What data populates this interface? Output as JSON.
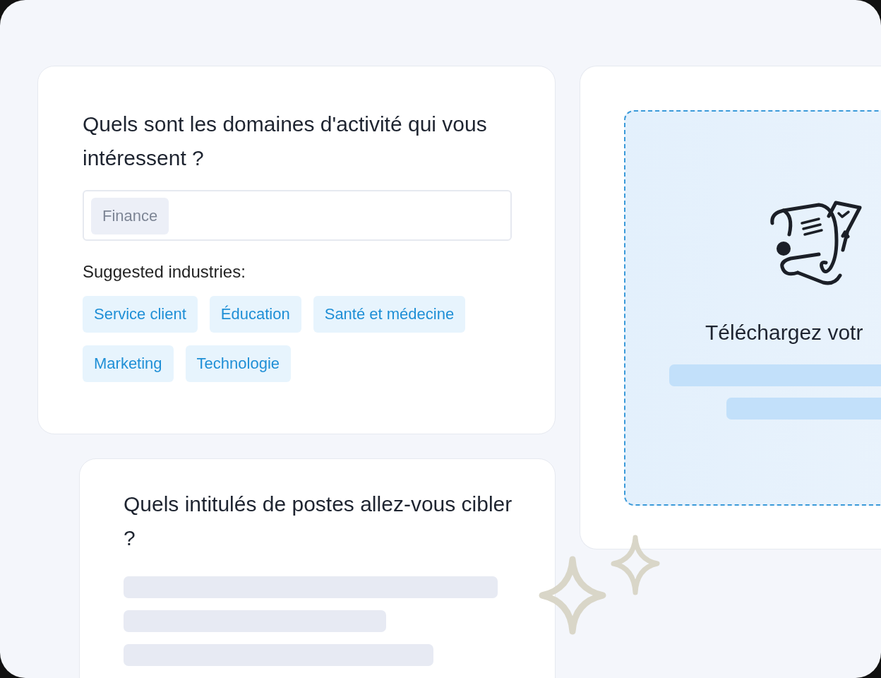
{
  "industry_card": {
    "title": "Quels sont les domaines d'activité qui vous intéressent ?",
    "selected_tags": [
      "Finance"
    ],
    "suggestions_label": "Suggested industries:",
    "suggestions": [
      "Service client",
      "Éducation",
      "Santé et médecine",
      "Marketing",
      "Technologie"
    ]
  },
  "upload_card": {
    "title": "Téléchargez votr"
  },
  "job_title_card": {
    "title": "Quels intitulés de postes allez-vous cibler ?"
  }
}
